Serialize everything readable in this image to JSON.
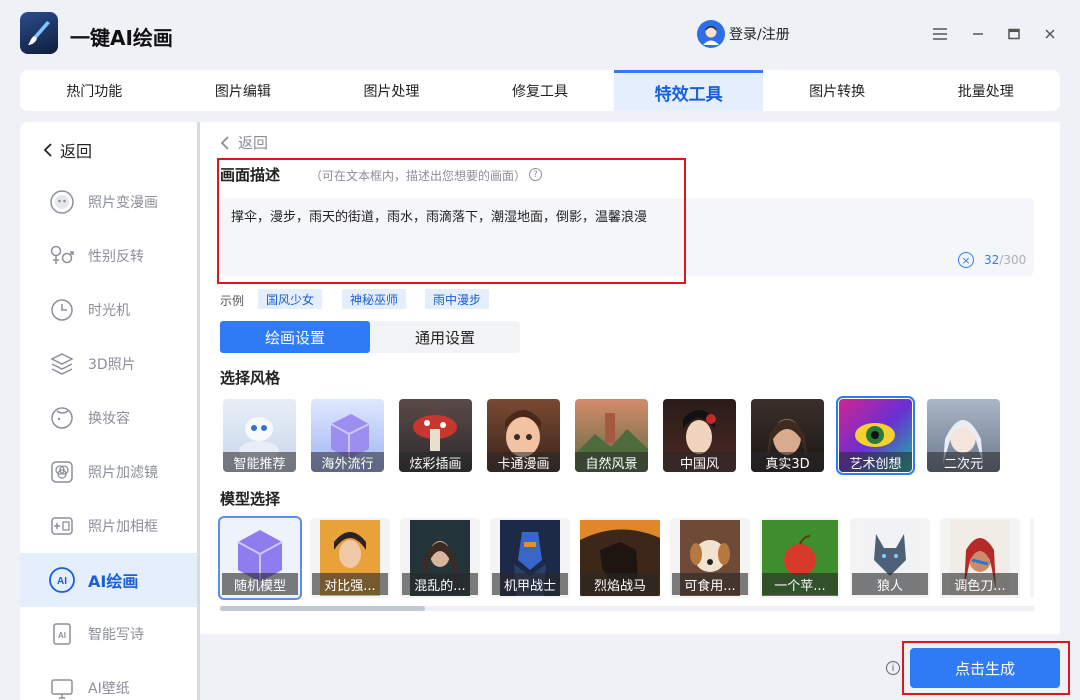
{
  "app": {
    "title": "一键AI绘画",
    "login_label": "登录/注册"
  },
  "topnav": {
    "tabs": [
      {
        "label": "热门功能",
        "active": false
      },
      {
        "label": "图片编辑",
        "active": false
      },
      {
        "label": "图片处理",
        "active": false
      },
      {
        "label": "修复工具",
        "active": false
      },
      {
        "label": "特效工具",
        "active": true
      },
      {
        "label": "图片转换",
        "active": false
      },
      {
        "label": "批量处理",
        "active": false
      }
    ]
  },
  "sidebar": {
    "back_label": "返回",
    "items": [
      {
        "label": "照片变漫画",
        "icon": "mask-icon"
      },
      {
        "label": "性别反转",
        "icon": "gender-icon"
      },
      {
        "label": "时光机",
        "icon": "clock-icon"
      },
      {
        "label": "3D照片",
        "icon": "layers-icon"
      },
      {
        "label": "换妆容",
        "icon": "face-icon"
      },
      {
        "label": "照片加滤镜",
        "icon": "filter-icon"
      },
      {
        "label": "照片加相框",
        "icon": "frame-icon"
      },
      {
        "label": "AI绘画",
        "icon": "ai-paint-icon",
        "active": true
      },
      {
        "label": "智能写诗",
        "icon": "ai-poem-icon"
      },
      {
        "label": "AI壁纸",
        "icon": "wallpaper-icon"
      }
    ]
  },
  "main": {
    "back_label": "返回",
    "description": {
      "label": "画面描述",
      "hint": "（可在文本框内，描述出您想要的画面）",
      "help_glyph": "?",
      "value": "撑伞，漫步，雨天的街道，雨水，雨滴落下，潮湿地面，倒影，温馨浪漫",
      "count": "32",
      "max": "/300",
      "clear_glyph": "×"
    },
    "examples": {
      "label": "示例",
      "chips": [
        "国风少女",
        "神秘巫师",
        "雨中漫步"
      ]
    },
    "settings_tabs": [
      {
        "label": "绘画设置",
        "active": true
      },
      {
        "label": "通用设置",
        "active": false
      }
    ],
    "style_section": {
      "title": "选择风格",
      "styles": [
        {
          "label": "智能推荐"
        },
        {
          "label": "海外流行"
        },
        {
          "label": "炫彩插画"
        },
        {
          "label": "卡通漫画"
        },
        {
          "label": "自然风景"
        },
        {
          "label": "中国风"
        },
        {
          "label": "真实3D"
        },
        {
          "label": "艺术创想",
          "selected": true
        },
        {
          "label": "二次元"
        }
      ]
    },
    "model_section": {
      "title": "模型选择",
      "models": [
        {
          "label": "随机模型",
          "selected": true
        },
        {
          "label": "对比强..."
        },
        {
          "label": "混乱的..."
        },
        {
          "label": "机甲战士"
        },
        {
          "label": "烈焰战马"
        },
        {
          "label": "可食用..."
        },
        {
          "label": "一个苹..."
        },
        {
          "label": "狼人"
        },
        {
          "label": "调色刀..."
        }
      ]
    }
  },
  "footer": {
    "info_glyph": "i",
    "generate_label": "点击生成"
  },
  "colors": {
    "accent": "#2f7bf5",
    "accent_light": "#e4eefc",
    "highlight_box": "#e0161c",
    "muted_text": "#8a8f99"
  }
}
